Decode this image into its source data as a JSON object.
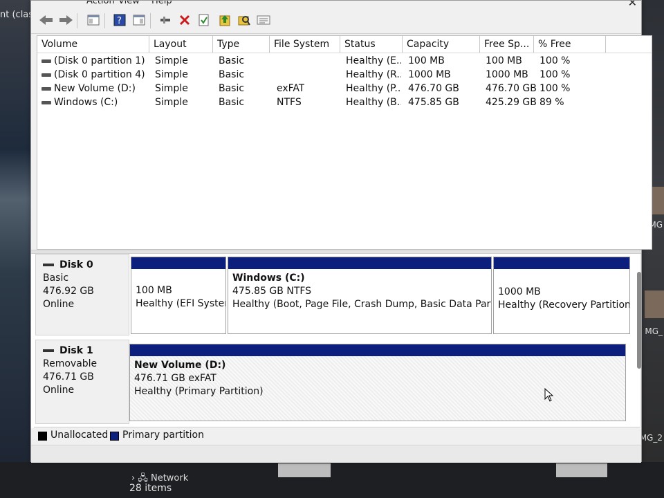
{
  "background": {
    "left_window_title": "nt (class",
    "right_labels": [
      "MG",
      "MG_",
      "MG_2"
    ],
    "taskbar_item": "Network",
    "items_count": "28 items"
  },
  "menu": {
    "items": [
      "Action",
      "View",
      "Help"
    ],
    "close_glyph": "✕"
  },
  "toolbar": {
    "icons": [
      "back-arrow-icon",
      "forward-arrow-icon",
      "console-tree-icon",
      "help-icon",
      "properties-pane-icon",
      "connect-icon",
      "delete-icon",
      "checkmark-icon",
      "import-icon",
      "search-folder-icon",
      "settings-icon"
    ]
  },
  "volume_list": {
    "columns": [
      "Volume",
      "Layout",
      "Type",
      "File System",
      "Status",
      "Capacity",
      "Free Sp...",
      "% Free"
    ],
    "rows": [
      {
        "volume": "(Disk 0 partition 1)",
        "layout": "Simple",
        "type": "Basic",
        "fs": "",
        "status": "Healthy (E...",
        "capacity": "100 MB",
        "free": "100 MB",
        "pct": "100 %"
      },
      {
        "volume": "(Disk 0 partition 4)",
        "layout": "Simple",
        "type": "Basic",
        "fs": "",
        "status": "Healthy (R...",
        "capacity": "1000 MB",
        "free": "1000 MB",
        "pct": "100 %"
      },
      {
        "volume": "New Volume (D:)",
        "layout": "Simple",
        "type": "Basic",
        "fs": "exFAT",
        "status": "Healthy (P...",
        "capacity": "476.70 GB",
        "free": "476.70 GB",
        "pct": "100 %"
      },
      {
        "volume": "Windows (C:)",
        "layout": "Simple",
        "type": "Basic",
        "fs": "NTFS",
        "status": "Healthy (B...",
        "capacity": "475.85 GB",
        "free": "425.29 GB",
        "pct": "89 %"
      }
    ]
  },
  "disks": [
    {
      "name": "Disk 0",
      "kind": "Basic",
      "size": "476.92 GB",
      "state": "Online",
      "partitions": [
        {
          "title": "",
          "line1": "100 MB",
          "line2": "Healthy (EFI Systen"
        },
        {
          "title": "Windows  (C:)",
          "line1": "475.85 GB NTFS",
          "line2": "Healthy (Boot, Page File, Crash Dump, Basic Data Partition)"
        },
        {
          "title": "",
          "line1": "1000 MB",
          "line2": "Healthy (Recovery Partition)"
        }
      ]
    },
    {
      "name": "Disk 1",
      "kind": "Removable",
      "size": "476.71 GB",
      "state": "Online",
      "partitions": [
        {
          "title": "New Volume  (D:)",
          "line1": "476.71 GB exFAT",
          "line2": "Healthy (Primary Partition)"
        }
      ]
    }
  ],
  "legend": {
    "unallocated": "Unallocated",
    "primary": "Primary partition",
    "unallocated_color": "#000000",
    "primary_color": "#0d1f7c"
  }
}
